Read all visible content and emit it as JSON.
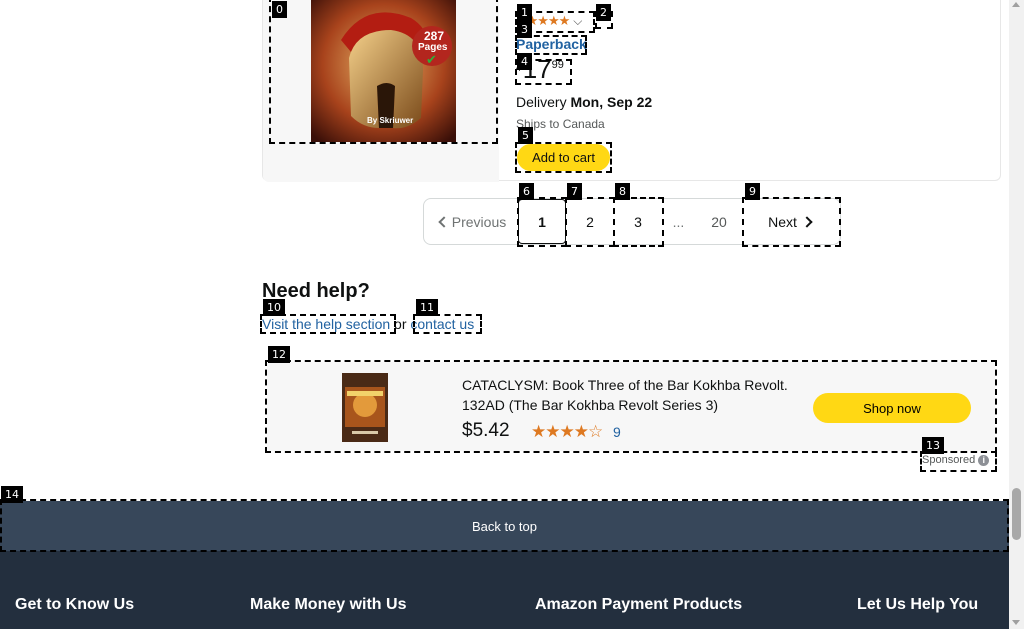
{
  "product": {
    "cover_pages_badge": "287",
    "cover_pages_word": "Pages",
    "cover_author": "By Skriuwer",
    "stars": "★★★★★",
    "format": "Paperback",
    "price_symbol": "$",
    "price_whole": "17",
    "price_fraction": "99",
    "delivery_label": "Delivery",
    "delivery_date": "Mon, Sep 22",
    "ships_to": "Ships to Canada",
    "add_to_cart": "Add to cart"
  },
  "pagination": {
    "previous": "Previous",
    "pages": [
      "1",
      "2",
      "3"
    ],
    "ellipsis": "...",
    "last": "20",
    "next": "Next"
  },
  "help": {
    "title": "Need help?",
    "help_link": "Visit the help section",
    "or": "or",
    "contact_link": "contact us"
  },
  "ad": {
    "title": "CATACLYSM: Book Three of the Bar Kokhba Revolt. 132AD (The Bar Kokhba Revolt Series 3)",
    "price": "$5.42",
    "stars": "★★★★☆",
    "rating_count": "9",
    "shop_now": "Shop now",
    "sponsored": "Sponsored"
  },
  "footer": {
    "back_to_top": "Back to top",
    "columns": [
      "Get to Know Us",
      "Make Money with Us",
      "Amazon Payment Products",
      "Let Us Help You"
    ]
  },
  "annotations": [
    "0",
    "1",
    "2",
    "3",
    "4",
    "5",
    "6",
    "7",
    "8",
    "9",
    "10",
    "11",
    "12",
    "13",
    "14"
  ],
  "colors": {
    "accent": "#ffd814",
    "link": "#2162a1",
    "star": "#de7921",
    "footer": "#232f3e",
    "back_to_top": "#37475a"
  }
}
